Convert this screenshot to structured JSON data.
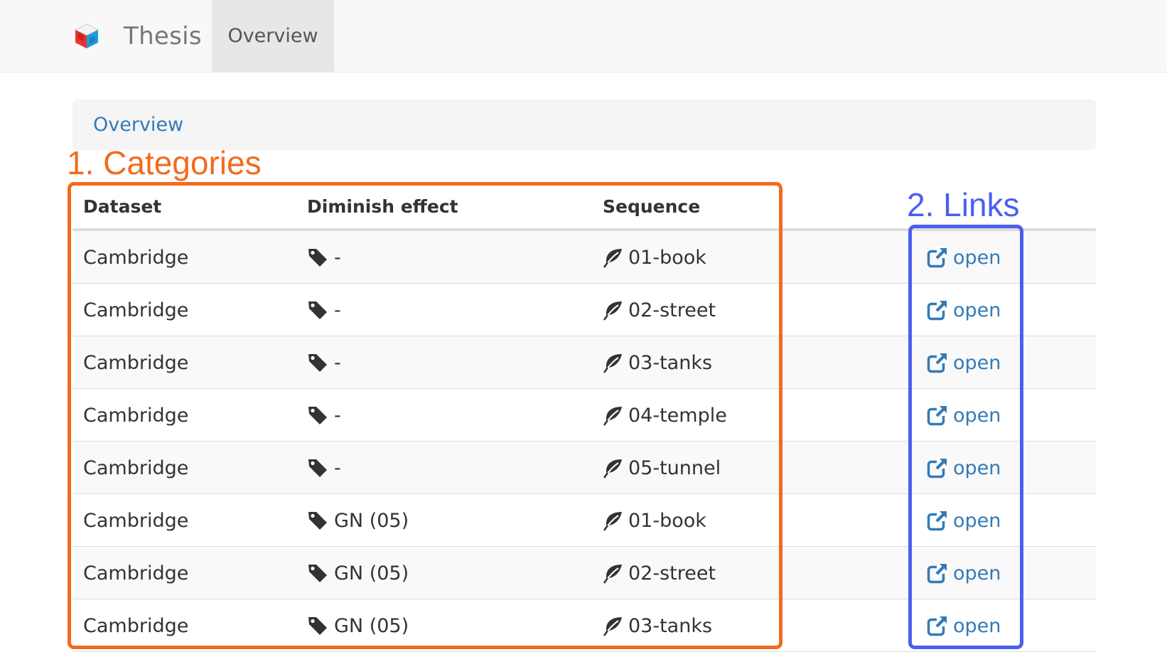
{
  "navbar": {
    "brand": "Thesis",
    "tab": "Overview"
  },
  "breadcrumb": {
    "current": "Overview"
  },
  "annotations": {
    "categories": "1. Categories",
    "links": "2. Links",
    "categories_color": "#f26b1d",
    "links_color": "#4a5ff0"
  },
  "table": {
    "headers": {
      "dataset": "Dataset",
      "diminish": "Diminish effect",
      "sequence": "Sequence"
    },
    "rows": [
      {
        "dataset": "Cambridge",
        "diminish": "-",
        "sequence": "01-book",
        "link": "open"
      },
      {
        "dataset": "Cambridge",
        "diminish": "-",
        "sequence": "02-street",
        "link": "open"
      },
      {
        "dataset": "Cambridge",
        "diminish": "-",
        "sequence": "03-tanks",
        "link": "open"
      },
      {
        "dataset": "Cambridge",
        "diminish": "-",
        "sequence": "04-temple",
        "link": "open"
      },
      {
        "dataset": "Cambridge",
        "diminish": "-",
        "sequence": "05-tunnel",
        "link": "open"
      },
      {
        "dataset": "Cambridge",
        "diminish": "GN (05)",
        "sequence": "01-book",
        "link": "open"
      },
      {
        "dataset": "Cambridge",
        "diminish": "GN (05)",
        "sequence": "02-street",
        "link": "open"
      },
      {
        "dataset": "Cambridge",
        "diminish": "GN (05)",
        "sequence": "03-tanks",
        "link": "open"
      }
    ]
  },
  "icons": {
    "logo": "cube-logo-icon",
    "diminish": "tag-icon",
    "sequence": "leaf-icon",
    "link": "external-link-icon"
  },
  "colors": {
    "link": "#337ab7",
    "navbar_bg": "#f8f8f8",
    "active_tab_bg": "#e7e7e7",
    "stripe": "#f9f9f9"
  }
}
